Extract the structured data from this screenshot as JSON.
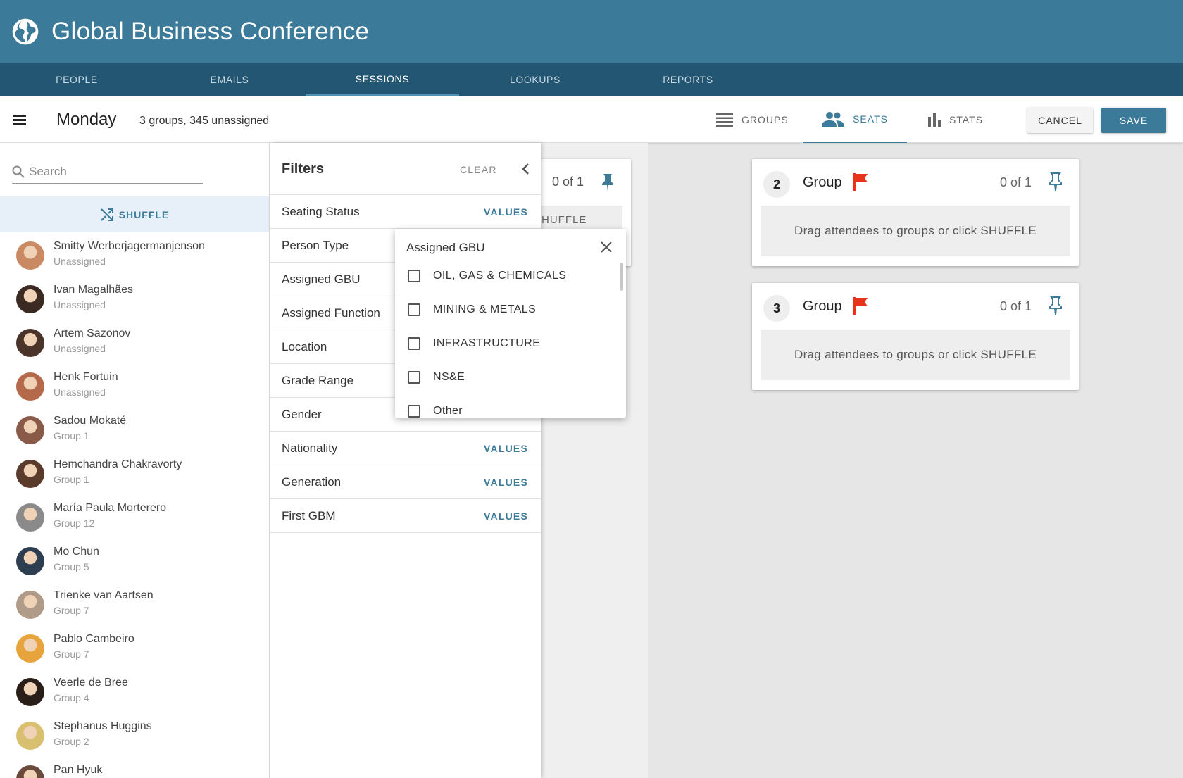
{
  "app": {
    "title": "Global Business Conference"
  },
  "nav": {
    "tabs": [
      "PEOPLE",
      "EMAILS",
      "SESSIONS",
      "LOOKUPS",
      "REPORTS"
    ],
    "active": "SESSIONS"
  },
  "toolbar": {
    "day": "Monday",
    "summary": "3 groups, 345 unassigned",
    "views": [
      {
        "label": "GROUPS",
        "icon": "list-icon"
      },
      {
        "label": "SEATS",
        "icon": "people-icon",
        "active": true
      },
      {
        "label": "STATS",
        "icon": "bar-chart-icon"
      }
    ],
    "cancel_label": "CANCEL",
    "save_label": "SAVE"
  },
  "left": {
    "search_placeholder": "Search",
    "shuffle_label": "SHUFFLE",
    "people": [
      {
        "name": "Smitty Werberjagermanjenson",
        "status": "Unassigned",
        "color": "#c98a63"
      },
      {
        "name": "Ivan Magalhães",
        "status": "Unassigned",
        "color": "#3a2a22"
      },
      {
        "name": "Artem Sazonov",
        "status": "Unassigned",
        "color": "#4a3328"
      },
      {
        "name": "Henk Fortuin",
        "status": "Unassigned",
        "color": "#b46a4a"
      },
      {
        "name": "Sadou Mokaté",
        "status": "Group 1",
        "color": "#8a5a48"
      },
      {
        "name": "Hemchandra Chakravorty",
        "status": "Group 1",
        "color": "#5a3a2a"
      },
      {
        "name": "María Paula Morterero",
        "status": "Group 12",
        "color": "#8a8a8a"
      },
      {
        "name": "Mo Chun",
        "status": "Group 5",
        "color": "#2c3e50"
      },
      {
        "name": "Trienke van Aartsen",
        "status": "Group 7",
        "color": "#b09a88"
      },
      {
        "name": "Pablo Cambeiro",
        "status": "Group 7",
        "color": "#e8a43c"
      },
      {
        "name": "Veerle de Bree",
        "status": "Group 4",
        "color": "#2a1e18"
      },
      {
        "name": "Stephanus Huggins",
        "status": "Group 2",
        "color": "#d8c070"
      },
      {
        "name": "Pan Hyuk",
        "status": "",
        "color": "#6a4a3a"
      }
    ]
  },
  "filters": {
    "title": "Filters",
    "clear_label": "CLEAR",
    "rows": [
      {
        "label": "Seating Status",
        "values": "VALUES"
      },
      {
        "label": "Person Type",
        "values": ""
      },
      {
        "label": "Assigned GBU",
        "values": ""
      },
      {
        "label": "Assigned Function",
        "values": ""
      },
      {
        "label": "Location",
        "values": ""
      },
      {
        "label": "Grade Range",
        "values": ""
      },
      {
        "label": "Gender",
        "values": ""
      },
      {
        "label": "Nationality",
        "values": "VALUES"
      },
      {
        "label": "Generation",
        "values": "VALUES"
      },
      {
        "label": "First GBM",
        "values": "VALUES"
      }
    ]
  },
  "popup": {
    "title": "Assigned GBU",
    "options": [
      "OIL, GAS & CHEMICALS",
      "MINING & METALS",
      "INFRASTRUCTURE",
      "NS&E",
      "Other"
    ]
  },
  "group1": {
    "count": "0 of 1",
    "drop_hint": "SHUFFLE"
  },
  "groups": [
    {
      "number": "2",
      "label": "Group",
      "count": "0 of 1",
      "hint": "Drag attendees to groups or click SHUFFLE"
    },
    {
      "number": "3",
      "label": "Group",
      "count": "0 of 1",
      "hint": "Drag attendees to groups or click SHUFFLE"
    }
  ],
  "colors": {
    "header": "#3c7a99",
    "nav": "#235672",
    "accent": "#3c7a99",
    "flag": "#e8331c"
  }
}
